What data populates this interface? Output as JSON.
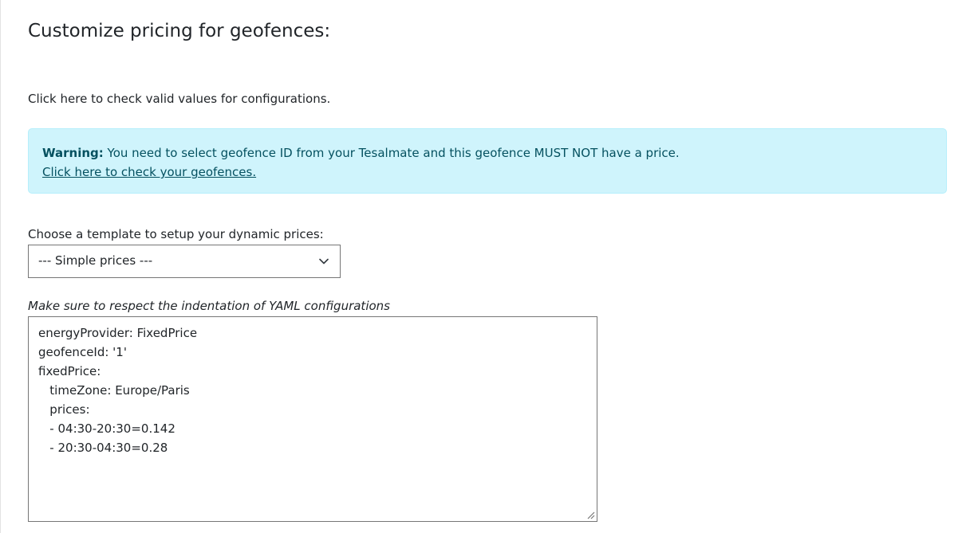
{
  "page": {
    "title": "Customize pricing for geofences:",
    "help_link": "Click here to check valid values for configurations."
  },
  "alert": {
    "label": "Warning:",
    "message": " You need to select geofence ID from your Tesalmate and this geofence MUST NOT have a price.",
    "link": "Click here to check your geofences.",
    "colors": {
      "background": "#cff4fc",
      "border": "#b6effb",
      "text": "#055160"
    }
  },
  "template": {
    "label": "Choose a template to setup your dynamic prices:",
    "selected": "--- Simple prices ---"
  },
  "yaml": {
    "note": "Make sure to respect the indentation of YAML configurations",
    "lines": [
      "energyProvider: FixedPrice",
      "geofenceId: '1'",
      "fixedPrice:",
      "   timeZone: Europe/Paris",
      "   prices:",
      "   - 04:30-20:30=0.142",
      "   - 20:30-04:30=0.28"
    ]
  }
}
